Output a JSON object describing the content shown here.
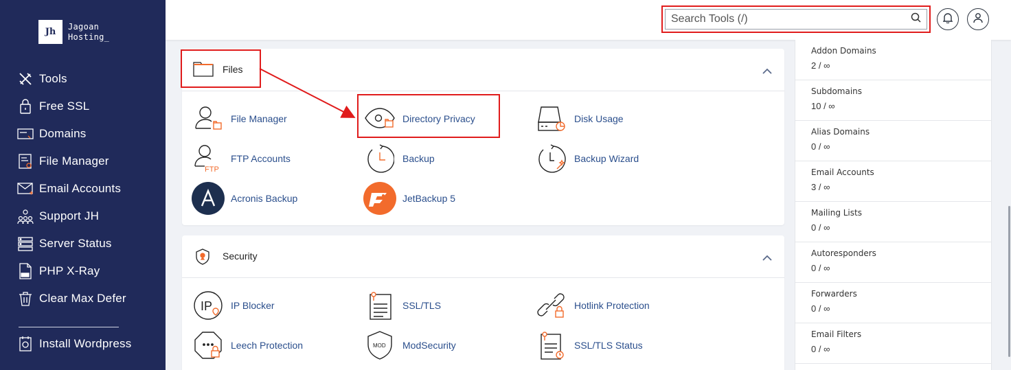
{
  "sidebar": {
    "logo_mark": "Jh",
    "logo_line1": "Jagoan",
    "logo_line2": "Hosting_",
    "items": [
      {
        "label": "Tools",
        "icon": "tools-icon"
      },
      {
        "label": "Free SSL",
        "icon": "ssl-icon"
      },
      {
        "label": "Domains",
        "icon": "domains-icon"
      },
      {
        "label": "File Manager",
        "icon": "file-manager-icon"
      },
      {
        "label": "Email Accounts",
        "icon": "email-icon"
      },
      {
        "label": "Support JH",
        "icon": "support-icon"
      },
      {
        "label": "Server Status",
        "icon": "server-icon"
      },
      {
        "label": "PHP X-Ray",
        "icon": "php-icon"
      },
      {
        "label": "Clear Max Defer",
        "icon": "trash-icon"
      }
    ],
    "bottom_item": {
      "label": "Install Wordpress",
      "icon": "wordpress-install-icon"
    }
  },
  "header": {
    "search_placeholder": "Search Tools (/)"
  },
  "files_panel": {
    "title": "Files",
    "tools": [
      {
        "label": "File Manager"
      },
      {
        "label": "Directory Privacy"
      },
      {
        "label": "Disk Usage"
      },
      {
        "label": "FTP Accounts"
      },
      {
        "label": "Backup"
      },
      {
        "label": "Backup Wizard"
      },
      {
        "label": "Acronis Backup"
      },
      {
        "label": "JetBackup 5"
      }
    ]
  },
  "security_panel": {
    "title": "Security",
    "tools": [
      {
        "label": "IP Blocker"
      },
      {
        "label": "SSL/TLS"
      },
      {
        "label": "Hotlink Protection"
      },
      {
        "label": "Leech Protection"
      },
      {
        "label": "ModSecurity"
      },
      {
        "label": "SSL/TLS Status"
      }
    ]
  },
  "icon_text": {
    "ftp": "FTP",
    "ip": "IP",
    "mod": "MOD"
  },
  "stats": [
    {
      "label": "Addon Domains",
      "value": "2 / ∞"
    },
    {
      "label": "Subdomains",
      "value": "10 / ∞"
    },
    {
      "label": "Alias Domains",
      "value": "0 / ∞"
    },
    {
      "label": "Email Accounts",
      "value": "3 / ∞"
    },
    {
      "label": "Mailing Lists",
      "value": "0 / ∞"
    },
    {
      "label": "Autoresponders",
      "value": "0 / ∞"
    },
    {
      "label": "Forwarders",
      "value": "0 / ∞"
    },
    {
      "label": "Email Filters",
      "value": "0 / ∞"
    }
  ],
  "colors": {
    "sidebar_bg": "#202a5a",
    "accent_orange": "#f26b2c",
    "link_blue": "#2a4e8c",
    "highlight_red": "#e01b1b"
  }
}
